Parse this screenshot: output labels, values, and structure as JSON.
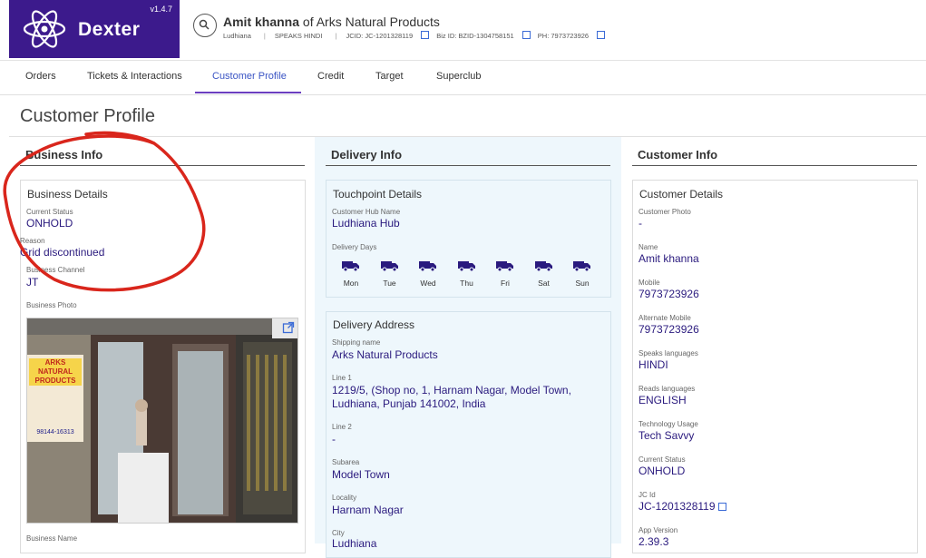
{
  "app": {
    "name": "Dexter",
    "version": "v1.4.7"
  },
  "customer": {
    "name": "Amit khanna",
    "of_label": "of",
    "business": "Arks Natural Products",
    "city": "Ludhiana",
    "speaks": "SPEAKS HINDI",
    "jcid": "JCID: JC-1201328119",
    "bizid": "Biz ID: BZID-1304758151",
    "phone": "PH: 7973723926"
  },
  "tabs": [
    "Orders",
    "Tickets & Interactions",
    "Customer Profile",
    "Credit",
    "Target",
    "Superclub"
  ],
  "active_tab": "Customer Profile",
  "page_title": "Customer Profile",
  "business_info": {
    "heading": "Business Info",
    "card_title": "Business Details",
    "current_status_label": "Current Status",
    "current_status": "ONHOLD",
    "reason_label": "Reason",
    "reason": "Grid discontinued",
    "channel_label": "Business Channel",
    "channel": "JT",
    "photo_label": "Business Photo",
    "name_label": "Business Name",
    "sign_text": "ARKS NATURAL PRODUCTS",
    "sign_phone": "98144-16313"
  },
  "delivery_info": {
    "heading": "Delivery Info",
    "touchpoint_title": "Touchpoint Details",
    "hub_label": "Customer Hub Name",
    "hub": "Ludhiana Hub",
    "days_label": "Delivery Days",
    "days": [
      "Mon",
      "Tue",
      "Wed",
      "Thu",
      "Fri",
      "Sat",
      "Sun"
    ],
    "address_title": "Delivery Address",
    "shipping_label": "Shipping name",
    "shipping": "Arks Natural Products",
    "line1_label": "Line 1",
    "line1_a": "1219/5, (Shop no, 1, Harnam Nagar, Model Town,",
    "line1_b": "Ludhiana, Punjab 141002, India",
    "line2_label": "Line 2",
    "line2": "-",
    "subarea_label": "Subarea",
    "subarea": "Model Town",
    "locality_label": "Locality",
    "locality": "Harnam Nagar",
    "city_label": "City",
    "city": "Ludhiana"
  },
  "customer_info": {
    "heading": "Customer Info",
    "card_title": "Customer Details",
    "photo_label": "Customer Photo",
    "photo": "-",
    "name_label": "Name",
    "name": "Amit khanna",
    "mobile_label": "Mobile",
    "mobile": "7973723926",
    "alt_mobile_label": "Alternate Mobile",
    "alt_mobile": "7973723926",
    "speaks_label": "Speaks languages",
    "speaks": "HINDI",
    "reads_label": "Reads languages",
    "reads": "ENGLISH",
    "tech_label": "Technology Usage",
    "tech": "Tech Savvy",
    "status_label": "Current Status",
    "status": "ONHOLD",
    "jcid_label": "JC Id",
    "jcid": "JC-1201328119",
    "app_version_label": "App Version",
    "app_version": "2.39.3"
  },
  "colors": {
    "brand": "#3c1a8c",
    "value": "#2a1a7e",
    "accent": "#6b3fc0",
    "delivery_bg": "#eef7fc",
    "annotation": "#d9261c"
  }
}
